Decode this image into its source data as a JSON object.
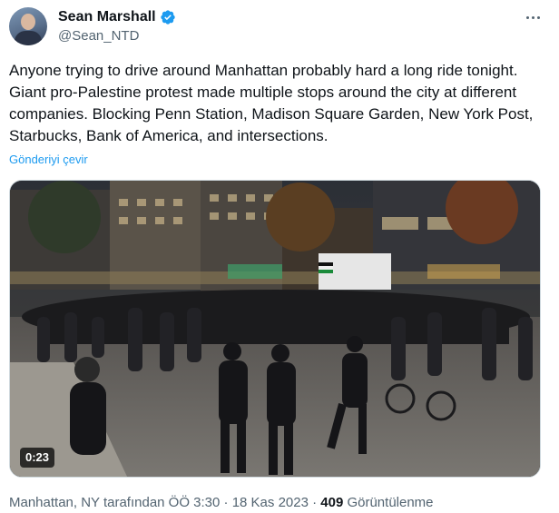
{
  "author": {
    "display_name": "Sean Marshall",
    "handle": "@Sean_NTD",
    "verified_icon": "verified-badge-icon",
    "verified_color": "#1d9bf0"
  },
  "tweet": {
    "text": "Anyone trying to drive around Manhattan probably hard a long ride tonight. Giant pro-Palestine protest made multiple stops around the city at different companies. Blocking Penn Station, Madison Square Garden, New York Post, Starbucks, Bank of America, and intersections.",
    "translate_label": "Gönderiyi çevir"
  },
  "media": {
    "duration": "0:23"
  },
  "meta": {
    "location_time": "Manhattan, NY tarafından ÖÖ 3:30 · 18 Kas 2023 · ",
    "views_count": "409",
    "views_label": " Görüntülenme"
  },
  "colors": {
    "text_primary": "#0f1419",
    "text_secondary": "#536471",
    "link": "#1d9bf0"
  }
}
